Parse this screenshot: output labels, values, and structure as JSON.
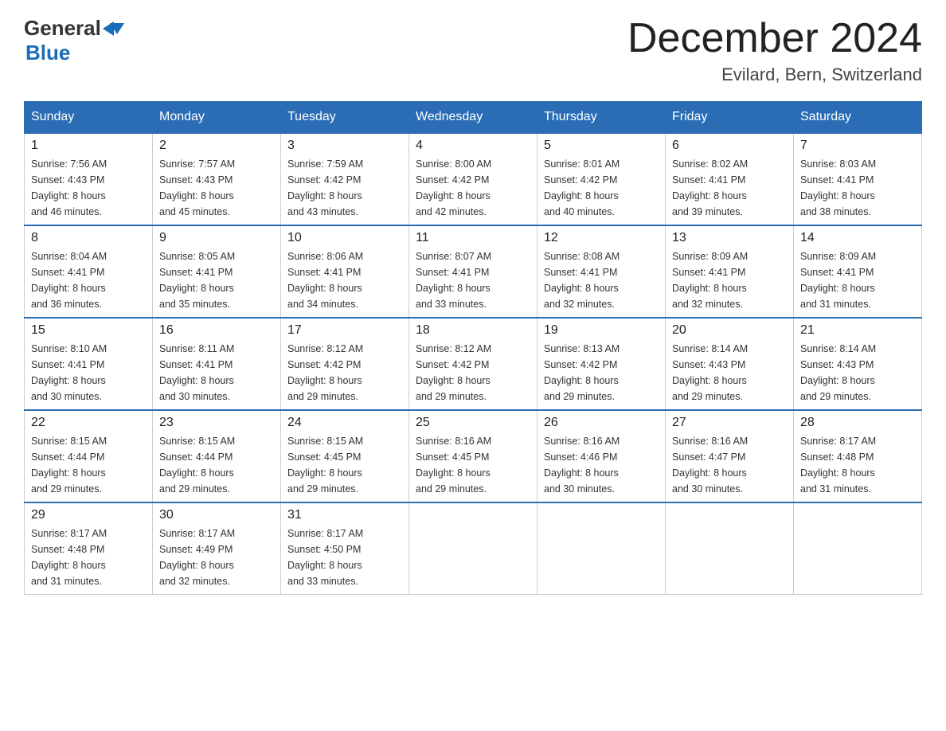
{
  "header": {
    "logo_general": "General",
    "logo_blue": "Blue",
    "month_title": "December 2024",
    "location": "Evilard, Bern, Switzerland"
  },
  "days_of_week": [
    "Sunday",
    "Monday",
    "Tuesday",
    "Wednesday",
    "Thursday",
    "Friday",
    "Saturday"
  ],
  "weeks": [
    [
      {
        "day": "1",
        "sunrise": "7:56 AM",
        "sunset": "4:43 PM",
        "daylight": "8 hours and 46 minutes."
      },
      {
        "day": "2",
        "sunrise": "7:57 AM",
        "sunset": "4:43 PM",
        "daylight": "8 hours and 45 minutes."
      },
      {
        "day": "3",
        "sunrise": "7:59 AM",
        "sunset": "4:42 PM",
        "daylight": "8 hours and 43 minutes."
      },
      {
        "day": "4",
        "sunrise": "8:00 AM",
        "sunset": "4:42 PM",
        "daylight": "8 hours and 42 minutes."
      },
      {
        "day": "5",
        "sunrise": "8:01 AM",
        "sunset": "4:42 PM",
        "daylight": "8 hours and 40 minutes."
      },
      {
        "day": "6",
        "sunrise": "8:02 AM",
        "sunset": "4:41 PM",
        "daylight": "8 hours and 39 minutes."
      },
      {
        "day": "7",
        "sunrise": "8:03 AM",
        "sunset": "4:41 PM",
        "daylight": "8 hours and 38 minutes."
      }
    ],
    [
      {
        "day": "8",
        "sunrise": "8:04 AM",
        "sunset": "4:41 PM",
        "daylight": "8 hours and 36 minutes."
      },
      {
        "day": "9",
        "sunrise": "8:05 AM",
        "sunset": "4:41 PM",
        "daylight": "8 hours and 35 minutes."
      },
      {
        "day": "10",
        "sunrise": "8:06 AM",
        "sunset": "4:41 PM",
        "daylight": "8 hours and 34 minutes."
      },
      {
        "day": "11",
        "sunrise": "8:07 AM",
        "sunset": "4:41 PM",
        "daylight": "8 hours and 33 minutes."
      },
      {
        "day": "12",
        "sunrise": "8:08 AM",
        "sunset": "4:41 PM",
        "daylight": "8 hours and 32 minutes."
      },
      {
        "day": "13",
        "sunrise": "8:09 AM",
        "sunset": "4:41 PM",
        "daylight": "8 hours and 32 minutes."
      },
      {
        "day": "14",
        "sunrise": "8:09 AM",
        "sunset": "4:41 PM",
        "daylight": "8 hours and 31 minutes."
      }
    ],
    [
      {
        "day": "15",
        "sunrise": "8:10 AM",
        "sunset": "4:41 PM",
        "daylight": "8 hours and 30 minutes."
      },
      {
        "day": "16",
        "sunrise": "8:11 AM",
        "sunset": "4:41 PM",
        "daylight": "8 hours and 30 minutes."
      },
      {
        "day": "17",
        "sunrise": "8:12 AM",
        "sunset": "4:42 PM",
        "daylight": "8 hours and 29 minutes."
      },
      {
        "day": "18",
        "sunrise": "8:12 AM",
        "sunset": "4:42 PM",
        "daylight": "8 hours and 29 minutes."
      },
      {
        "day": "19",
        "sunrise": "8:13 AM",
        "sunset": "4:42 PM",
        "daylight": "8 hours and 29 minutes."
      },
      {
        "day": "20",
        "sunrise": "8:14 AM",
        "sunset": "4:43 PM",
        "daylight": "8 hours and 29 minutes."
      },
      {
        "day": "21",
        "sunrise": "8:14 AM",
        "sunset": "4:43 PM",
        "daylight": "8 hours and 29 minutes."
      }
    ],
    [
      {
        "day": "22",
        "sunrise": "8:15 AM",
        "sunset": "4:44 PM",
        "daylight": "8 hours and 29 minutes."
      },
      {
        "day": "23",
        "sunrise": "8:15 AM",
        "sunset": "4:44 PM",
        "daylight": "8 hours and 29 minutes."
      },
      {
        "day": "24",
        "sunrise": "8:15 AM",
        "sunset": "4:45 PM",
        "daylight": "8 hours and 29 minutes."
      },
      {
        "day": "25",
        "sunrise": "8:16 AM",
        "sunset": "4:45 PM",
        "daylight": "8 hours and 29 minutes."
      },
      {
        "day": "26",
        "sunrise": "8:16 AM",
        "sunset": "4:46 PM",
        "daylight": "8 hours and 30 minutes."
      },
      {
        "day": "27",
        "sunrise": "8:16 AM",
        "sunset": "4:47 PM",
        "daylight": "8 hours and 30 minutes."
      },
      {
        "day": "28",
        "sunrise": "8:17 AM",
        "sunset": "4:48 PM",
        "daylight": "8 hours and 31 minutes."
      }
    ],
    [
      {
        "day": "29",
        "sunrise": "8:17 AM",
        "sunset": "4:48 PM",
        "daylight": "8 hours and 31 minutes."
      },
      {
        "day": "30",
        "sunrise": "8:17 AM",
        "sunset": "4:49 PM",
        "daylight": "8 hours and 32 minutes."
      },
      {
        "day": "31",
        "sunrise": "8:17 AM",
        "sunset": "4:50 PM",
        "daylight": "8 hours and 33 minutes."
      },
      null,
      null,
      null,
      null
    ]
  ],
  "labels": {
    "sunrise_prefix": "Sunrise: ",
    "sunset_prefix": "Sunset: ",
    "daylight_prefix": "Daylight: "
  }
}
